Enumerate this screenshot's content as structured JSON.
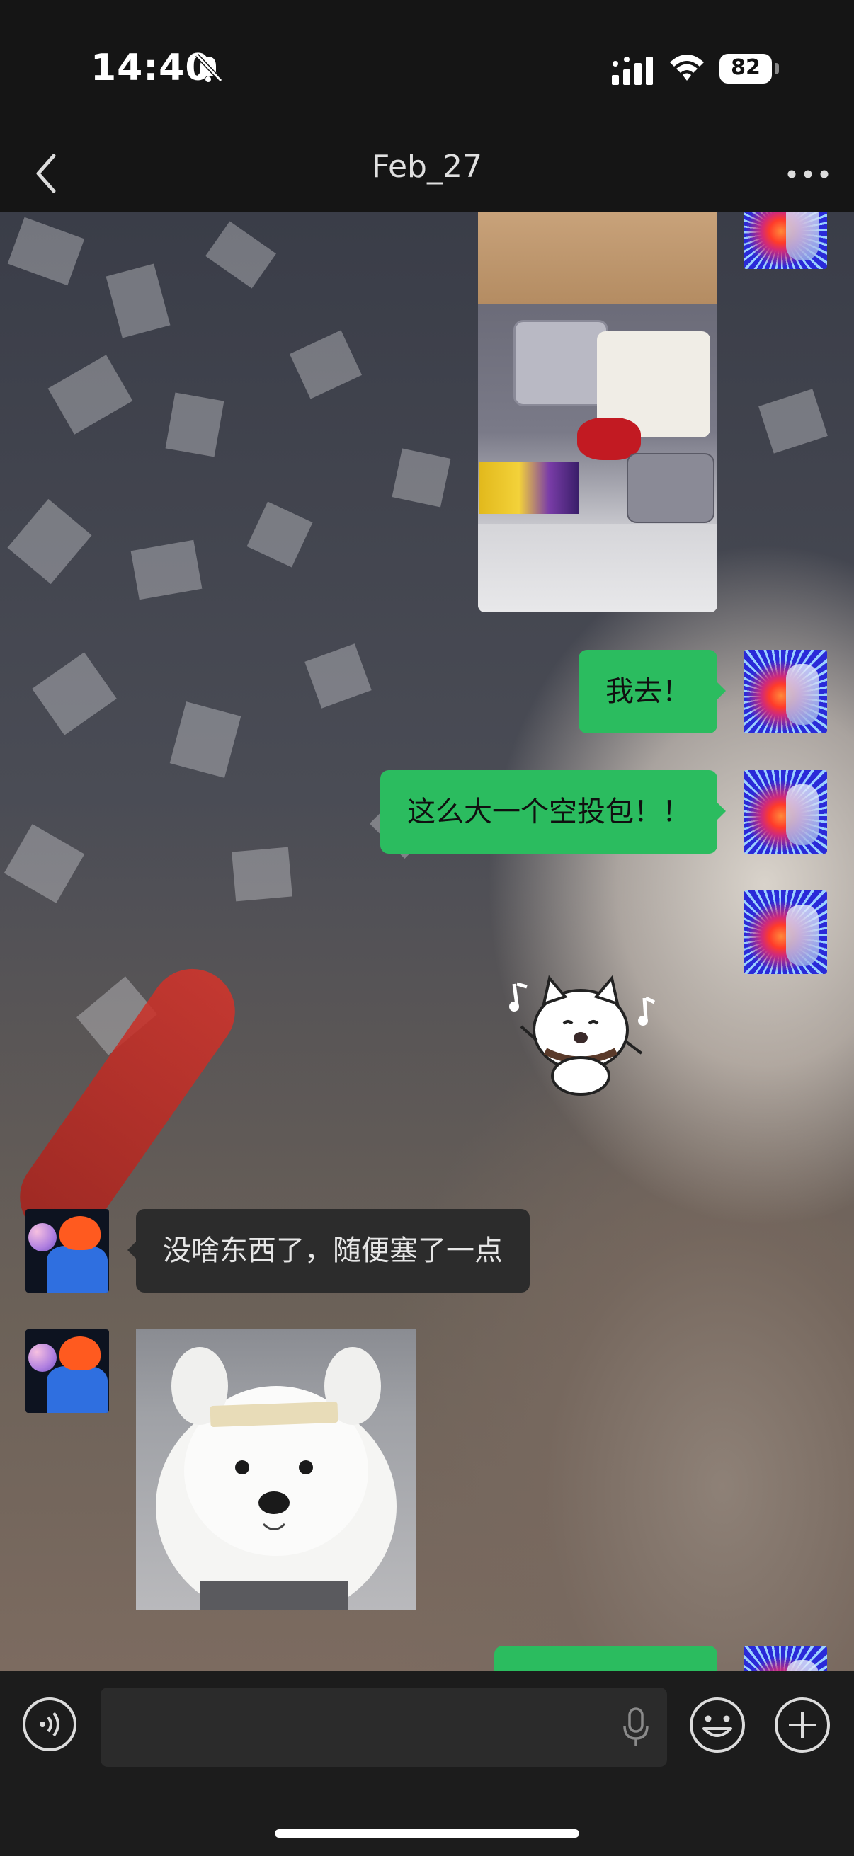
{
  "status_bar": {
    "time": "14:40",
    "battery": "82",
    "icons": [
      "bell-slash-icon",
      "cellular-signal-icon",
      "wifi-icon",
      "battery-icon"
    ]
  },
  "nav": {
    "title": "Feb_27",
    "back_icon": "chevron-left-icon",
    "more_icon": "ellipsis-icon"
  },
  "messages": [
    {
      "sender": "me",
      "type": "image",
      "description_icon": "photo"
    },
    {
      "sender": "me",
      "type": "text",
      "text": "我去！"
    },
    {
      "sender": "me",
      "type": "text",
      "text": "这么大一个空投包！！"
    },
    {
      "sender": "me",
      "type": "sticker",
      "sticker": "dancing-cat-sticker"
    },
    {
      "sender": "other",
      "type": "text",
      "text": "没啥东西了，随便塞了一点"
    },
    {
      "sender": "other",
      "type": "image",
      "sticker": "samoyed-dog-sticker"
    },
    {
      "sender": "me",
      "type": "text",
      "text": ""
    }
  ],
  "input_bar": {
    "voice_icon": "voice-input-icon",
    "mic_icon": "microphone-icon",
    "emoji_icon": "emoji-icon",
    "plus_icon": "plus-icon"
  },
  "colors": {
    "my_bubble": "#2bbc5f",
    "other_bubble": "#2c2c2c",
    "bar_background": "#151515"
  }
}
